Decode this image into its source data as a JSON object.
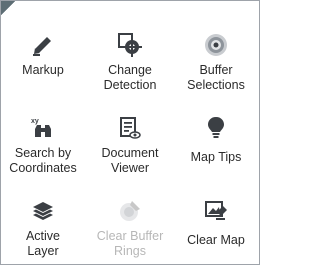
{
  "tools": [
    {
      "label": "Markup",
      "icon": "marker-icon",
      "enabled": true
    },
    {
      "label": "Change Detection",
      "icon": "crosshair-globe-icon",
      "enabled": true
    },
    {
      "label": "Buffer Selections",
      "icon": "buffer-icon",
      "enabled": true
    },
    {
      "label": "Search by Coordinates",
      "icon": "binoculars-xy-icon",
      "enabled": true
    },
    {
      "label": "Document Viewer",
      "icon": "document-viewer-icon",
      "enabled": true
    },
    {
      "label": "Map Tips",
      "icon": "lightbulb-icon",
      "enabled": true
    },
    {
      "label": "Active Layer",
      "icon": "layers-icon",
      "enabled": true
    },
    {
      "label": "Clear Buffer Rings",
      "icon": "clear-buffer-icon",
      "enabled": false
    },
    {
      "label": "Clear Map",
      "icon": "clear-map-icon",
      "enabled": true
    }
  ],
  "colors": {
    "icon": "#3b3f44",
    "icon_disabled": "#c8c8c8",
    "text": "#2b2b2b",
    "text_disabled": "#b7b7b7",
    "border": "#9ea3aa"
  }
}
